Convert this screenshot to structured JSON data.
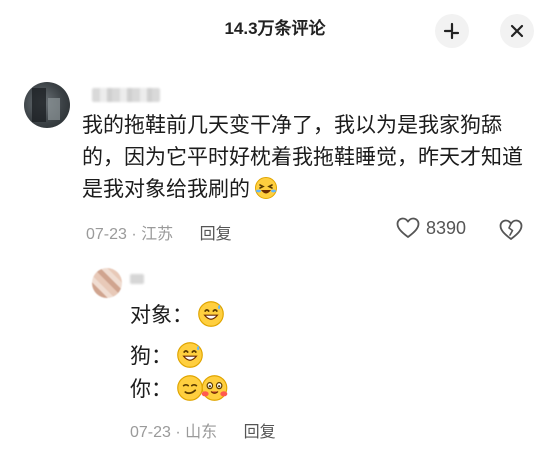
{
  "header": {
    "title": "14.3万条评论",
    "collapse_icon": "collapse-icon",
    "close_icon": "close-icon"
  },
  "comment": {
    "text": "我的拖鞋前几天变干净了，我以为是我家狗舔的，因为它平时好枕着我拖鞋睡觉，昨天才知道是我对象给我刷的",
    "emoji": "rolling-laughing-emoji",
    "date": "07-23",
    "separator": "·",
    "location": "江苏",
    "reply_label": "回复",
    "like_count": "8390",
    "like_icon": "heart-outline-icon",
    "dislike_icon": "broken-heart-icon"
  },
  "reply": {
    "lines": [
      {
        "speaker": "对象：",
        "emoji": "grinning-sweat-emoji"
      },
      {
        "speaker": "狗：",
        "emoji": "grinning-sweat-emoji"
      },
      {
        "speaker": "你：",
        "emoji": "smirk-and-hug-emoji"
      }
    ],
    "date": "07-23",
    "separator": "·",
    "location": "山东",
    "reply_label": "回复"
  }
}
